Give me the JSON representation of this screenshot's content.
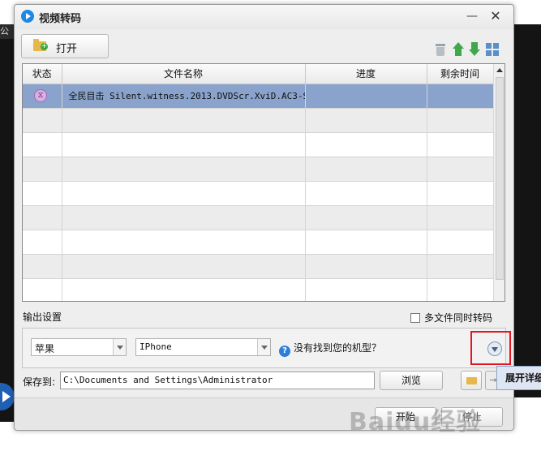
{
  "background": {
    "left_tab_text": "公播"
  },
  "window": {
    "title": "视频转码",
    "minimize_glyph": "—",
    "close_glyph": "✕"
  },
  "toolbar": {
    "open_label": "打开"
  },
  "table": {
    "columns": [
      "状态",
      "文件名称",
      "进度",
      "剩余时间"
    ],
    "rows": [
      {
        "status_icon": "hourglass-icon",
        "status_glyph": "⧖",
        "file_name": "全民目击 Silent.witness.2013.DVDScr.XviD.AC3-S…",
        "progress": "",
        "remaining": ""
      }
    ],
    "empty_rows": 9
  },
  "output": {
    "label": "输出设置",
    "multi_file_label": "多文件同时转码",
    "multi_file_checked": false,
    "brand_value": "苹果",
    "model_value": "IPhone",
    "help_text": "没有找到您的机型？",
    "help_glyph": "?"
  },
  "save": {
    "label": "保存到:",
    "path": "C:\\Documents and Settings\\Administrator",
    "browse_label": "浏览",
    "goto_glyph": "→"
  },
  "actions": {
    "start_label": "开始",
    "stop_label": "停止"
  },
  "tooltip": {
    "text": "展开详细"
  },
  "watermark": {
    "text": "Baidu经验"
  },
  "colors": {
    "selection": "#8aa3cc",
    "accent": "#2c7fd8",
    "highlight_box": "#e4161f"
  }
}
